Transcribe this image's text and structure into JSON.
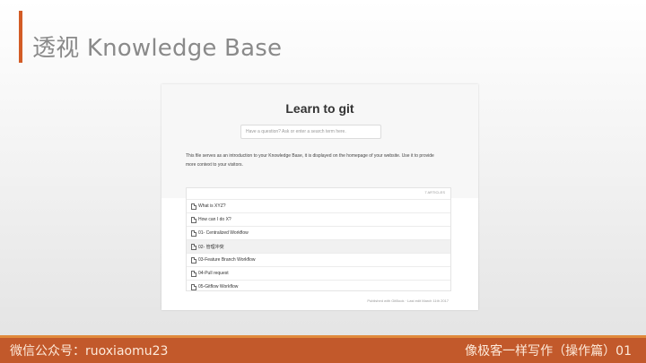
{
  "slide": {
    "title": "透视 Knowledge Base",
    "footer_left": "微信公众号：ruoxiaomu23",
    "footer_right": "像极客一样写作（操作篇）01",
    "accent_color": "#d35c26",
    "band_color": "#c2592b"
  },
  "kb": {
    "title": "Learn to git",
    "search_placeholder": "Have a question? Ask or enter a search term here.",
    "intro_line1": "This file serves as an introduction to your Knowledge Base, it is displayed on the homepage of your website. Use it to provide",
    "intro_line2": "more context to your visitors.",
    "articles_count": "7 ARTICLES",
    "articles": [
      {
        "label": "What is XYZ?"
      },
      {
        "label": "How can I do X?"
      },
      {
        "label": "01- Centralized Workflow"
      },
      {
        "label": "02- 管理冲突"
      },
      {
        "label": "03-Feature Branch Workflow"
      },
      {
        "label": "04-Pull request"
      },
      {
        "label": "05-Gitflow Workflow"
      }
    ],
    "footer_note": "Published with GitBook · Last edit March 11th 2017",
    "icons": {
      "article": "document-icon"
    }
  }
}
